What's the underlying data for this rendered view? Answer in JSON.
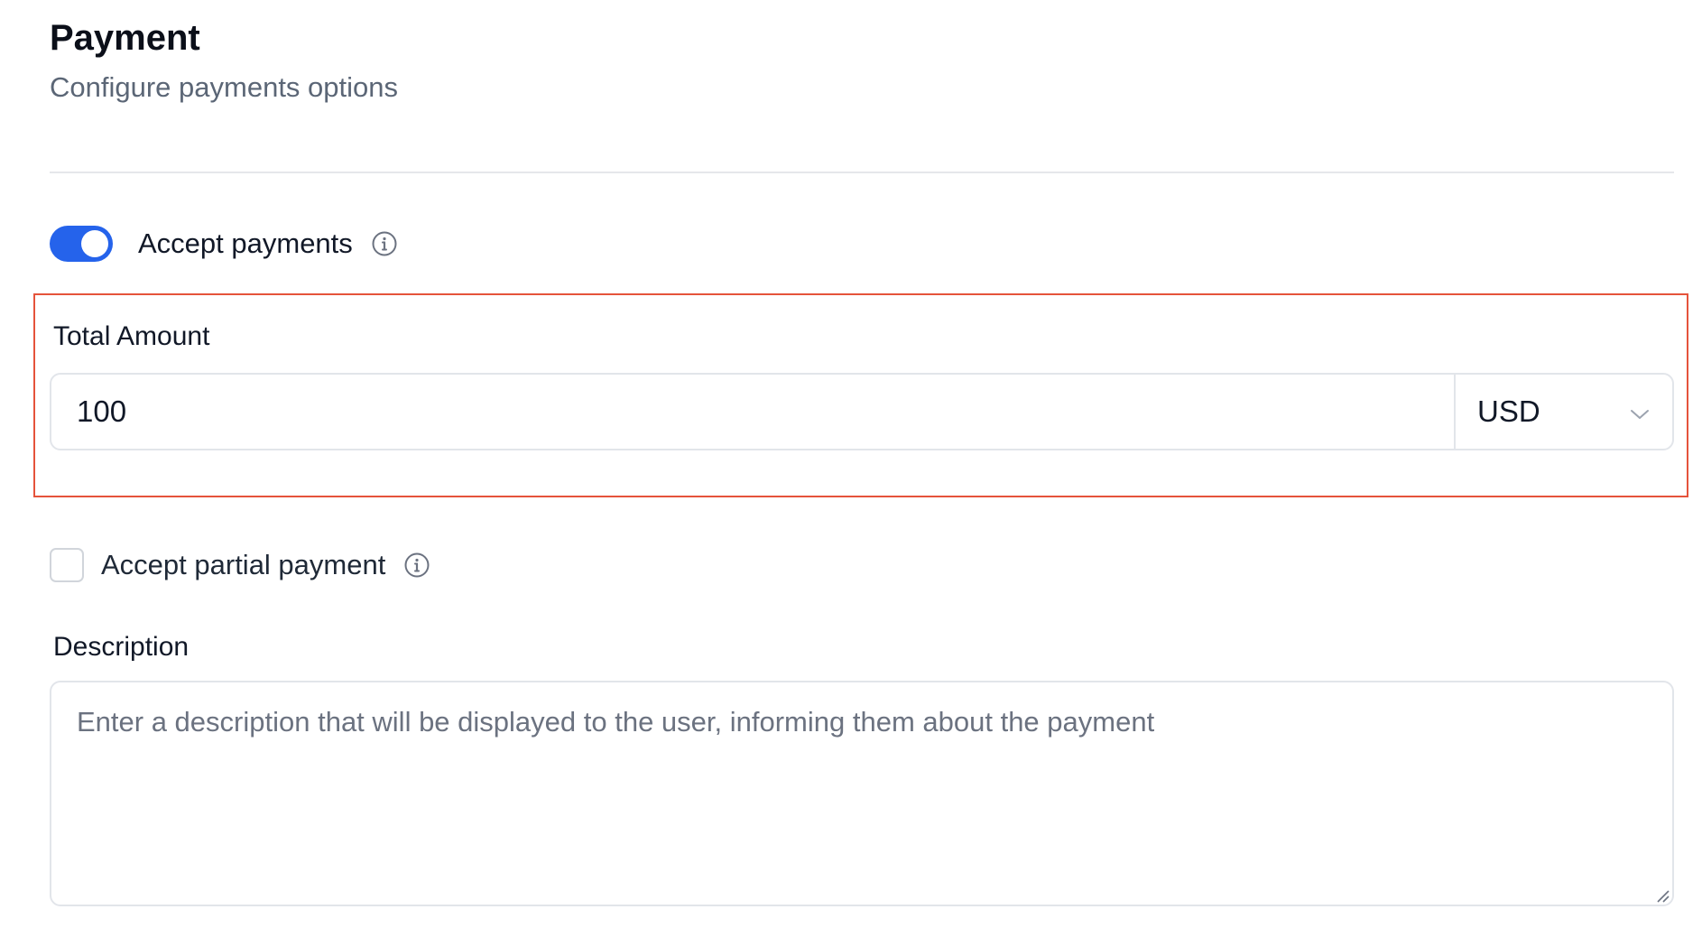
{
  "header": {
    "title": "Payment",
    "subtitle": "Configure payments options"
  },
  "accept_payments": {
    "label": "Accept payments",
    "enabled": true,
    "accent_color": "#2563eb"
  },
  "total_amount": {
    "label": "Total Amount",
    "value": "100",
    "currency": "USD",
    "highlight_color": "#e5533b"
  },
  "partial_payment": {
    "label": "Accept partial payment",
    "checked": false
  },
  "description": {
    "label": "Description",
    "value": "",
    "placeholder": "Enter a description that will be displayed to the user, informing them about the payment"
  },
  "icons": {
    "info": "info-circle-icon",
    "dropdown": "chevron-down-icon",
    "resize": "resize-handle-icon"
  }
}
